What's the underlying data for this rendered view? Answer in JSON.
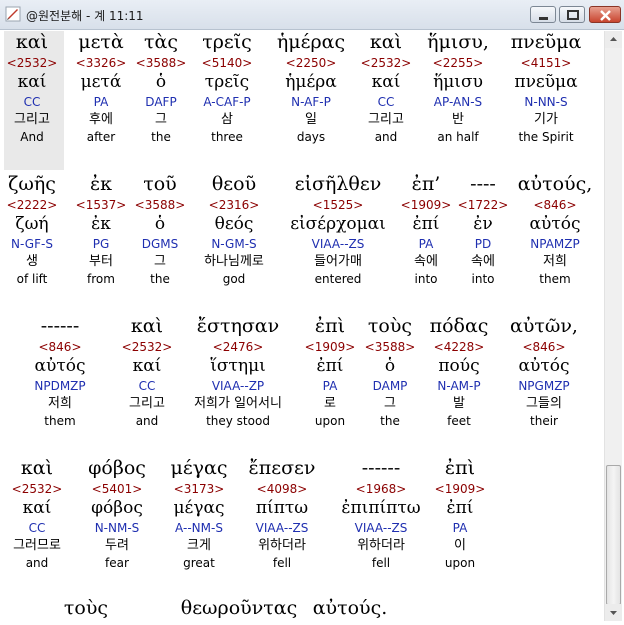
{
  "window": {
    "title": "@원전분해 - 계 11:11"
  },
  "rows": [
    [
      {
        "greek": "καὶ",
        "strong": "<2532>",
        "lemma": "καί",
        "morph": "CC",
        "korean": "그리고",
        "english": "And"
      },
      {
        "greek": "μετὰ",
        "strong": "<3326>",
        "lemma": "μετά",
        "morph": "PA",
        "korean": "후에",
        "english": "after"
      },
      {
        "greek": "τὰς",
        "strong": "<3588>",
        "lemma": "ὁ",
        "morph": "DAFP",
        "korean": "그",
        "english": "the"
      },
      {
        "greek": "τρεῖς",
        "strong": "<5140>",
        "lemma": "τρεῖς",
        "morph": "A-CAF-P",
        "korean": "삼",
        "english": "three"
      },
      {
        "greek": "ἡμέρας",
        "strong": "<2250>",
        "lemma": "ἡμέρα",
        "morph": "N-AF-P",
        "korean": "일",
        "english": "days"
      },
      {
        "greek": "καὶ",
        "strong": "<2532>",
        "lemma": "καί",
        "morph": "CC",
        "korean": "그리고",
        "english": "and"
      },
      {
        "greek": "ἥμισυ,",
        "strong": "<2255>",
        "lemma": "ἥμισυ",
        "morph": "AP-AN-S",
        "korean": "반",
        "english": "an half"
      },
      {
        "greek": "πνεῦμα",
        "strong": "<4151>",
        "lemma": "πνεῦμα",
        "morph": "N-NN-S",
        "korean": "기가",
        "english": "the Spirit"
      }
    ],
    [
      {
        "greek": "ζωῆς",
        "strong": "<2222>",
        "lemma": "ζωή",
        "morph": "N-GF-S",
        "korean": "생",
        "english": "of lift"
      },
      {
        "greek": "ἐκ",
        "strong": "<1537>",
        "lemma": "ἐκ",
        "morph": "PG",
        "korean": "부터",
        "english": "from"
      },
      {
        "greek": "τοῦ",
        "strong": "<3588>",
        "lemma": "ὁ",
        "morph": "DGMS",
        "korean": "그",
        "english": "the"
      },
      {
        "greek": "θεοῦ",
        "strong": "<2316>",
        "lemma": "θεός",
        "morph": "N-GM-S",
        "korean": "하나님께로",
        "english": "god"
      },
      {
        "greek": "εἰσῆλθεν",
        "strong": "<1525>",
        "lemma": "εἰσέρχομαι",
        "morph": "VIAA--ZS",
        "korean": "들어가매",
        "english": "entered"
      },
      {
        "greek": "ἐπ’",
        "strong": "<1909>",
        "lemma": "ἐπί",
        "morph": "PA",
        "korean": "속에",
        "english": "into"
      },
      {
        "greek": "----",
        "strong": "<1722>",
        "lemma": "ἐν",
        "morph": "PD",
        "korean": "속에",
        "english": "into"
      },
      {
        "greek": "αὐτούς,",
        "strong": "<846>",
        "lemma": "αὐτός",
        "morph": "NPAMZP",
        "korean": "저희",
        "english": "them"
      }
    ],
    [
      {
        "greek": "------",
        "strong": "<846>",
        "lemma": "αὐτός",
        "morph": "NPDMZP",
        "korean": "저희",
        "english": "them"
      },
      {
        "greek": "καὶ",
        "strong": "<2532>",
        "lemma": "καί",
        "morph": "CC",
        "korean": "그리고",
        "english": "and"
      },
      {
        "greek": "ἔστησαν",
        "strong": "<2476>",
        "lemma": "ἵστημι",
        "morph": "VIAA--ZP",
        "korean": "저희가 일어서니",
        "english": "they stood"
      },
      {
        "greek": "ἐπὶ",
        "strong": "<1909>",
        "lemma": "ἐπί",
        "morph": "PA",
        "korean": "로",
        "english": "upon"
      },
      {
        "greek": "τοὺς",
        "strong": "<3588>",
        "lemma": "ὁ",
        "morph": "DAMP",
        "korean": "그",
        "english": "the"
      },
      {
        "greek": "πόδας",
        "strong": "<4228>",
        "lemma": "πούς",
        "morph": "N-AM-P",
        "korean": "발",
        "english": "feet"
      },
      {
        "greek": "αὐτῶν,",
        "strong": "<846>",
        "lemma": "αὐτός",
        "morph": "NPGMZP",
        "korean": "그들의",
        "english": "their"
      }
    ],
    [
      {
        "greek": "καὶ",
        "strong": "<2532>",
        "lemma": "καί",
        "morph": "CC",
        "korean": "그러므로",
        "english": "and"
      },
      {
        "greek": "φόβος",
        "strong": "<5401>",
        "lemma": "φόβος",
        "morph": "N-NM-S",
        "korean": "두려",
        "english": "fear"
      },
      {
        "greek": "μέγας",
        "strong": "<3173>",
        "lemma": "μέγας",
        "morph": "A--NM-S",
        "korean": "크게",
        "english": "great"
      },
      {
        "greek": "ἔπεσεν",
        "strong": "<4098>",
        "lemma": "πίπτω",
        "morph": "VIAA--ZS",
        "korean": "위하더라",
        "english": "fell"
      },
      {
        "greek": "------",
        "strong": "<1968>",
        "lemma": "ἐπιπίπτω",
        "morph": "VIAA--ZS",
        "korean": "위하더라",
        "english": "fell"
      },
      {
        "greek": "ἐπὶ",
        "strong": "<1909>",
        "lemma": "ἐπί",
        "morph": "PA",
        "korean": "이",
        "english": "upon"
      }
    ],
    [
      {
        "greek": "τοὺς",
        "strong": "",
        "lemma": "",
        "morph": "",
        "korean": "",
        "english": ""
      },
      {
        "greek": "θεωροῦντας",
        "strong": "",
        "lemma": "",
        "morph": "",
        "korean": "",
        "english": ""
      },
      {
        "greek": "αὐτούς.",
        "strong": "",
        "lemma": "",
        "morph": "",
        "korean": "",
        "english": ""
      }
    ]
  ]
}
